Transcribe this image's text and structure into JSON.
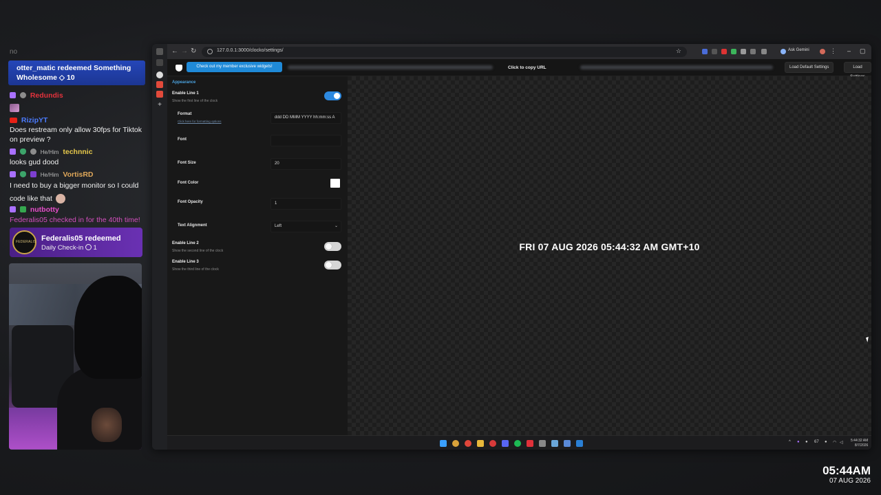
{
  "chat": {
    "faint_top": "no",
    "redeem_blue": {
      "line1": "otter_matic redeemed Something",
      "line2": "Wholesome",
      "points": "10"
    },
    "messages": [
      {
        "user": "Redundis",
        "text": ""
      },
      {
        "user": "RizipYT",
        "text": "Does restream only allow 30fps for Tiktok on preview ?"
      },
      {
        "pronouns": "He/Him",
        "user": "technnic",
        "text": "looks gud dood"
      },
      {
        "pronouns": "He/Him",
        "user": "VortisRD",
        "text": "I need to buy a bigger monitor so I could code like that"
      },
      {
        "user": "nutbotty",
        "text": "Federalis05 checked in for the 40th time!"
      }
    ],
    "redeem_purple": {
      "avatar_text": "FEDERALIS",
      "title": "Federalis05 redeemed",
      "subtitle": "Daily Check-in",
      "count": "1"
    }
  },
  "browser": {
    "url": "127.0.0.1:3000/clocko/settings/",
    "ask_label": "Ask Gemini",
    "header": {
      "member_button": "Check out my member exclusive widgets!",
      "copy_url": "Click to copy URL",
      "load_default": "Load Default Settings",
      "load_settings": "Load Settings"
    },
    "settings": {
      "section": "Appearance",
      "line1_title": "Enable Line 1",
      "line1_sub": "Show the first line of the clock",
      "format_label": "Format",
      "format_link": "Click here for formatting options",
      "format_value": "ddd DD MMM YYYY hh:mm:ss A",
      "font_label": "Font",
      "font_value": "",
      "font_size_label": "Font Size",
      "font_size_value": "20",
      "font_color_label": "Font Color",
      "font_color_value": "#ffffff",
      "font_opacity_label": "Font Opacity",
      "font_opacity_value": "1",
      "text_align_label": "Text Alignment",
      "text_align_value": "Left",
      "line2_title": "Enable Line 2",
      "line2_sub": "Show the second line of the clock",
      "line3_title": "Enable Line 3",
      "line3_sub": "Show the third line of the clock"
    },
    "preview_text": "FRI 07 AUG 2026 05:44:32 AM GMT+10",
    "taskbar": {
      "tray_temp": "67",
      "time": "5:44:32 AM",
      "date": "8/7/2026"
    }
  },
  "overlay_clock": {
    "time": "05:44AM",
    "date": "07 AUG 2026"
  },
  "colors": {
    "accent": "#2d89e0",
    "member_button": "#1f8ad8",
    "section_title": "#4ba3e0",
    "redeem_blue": "#2546b8",
    "redeem_purple": "#6a31b3"
  }
}
